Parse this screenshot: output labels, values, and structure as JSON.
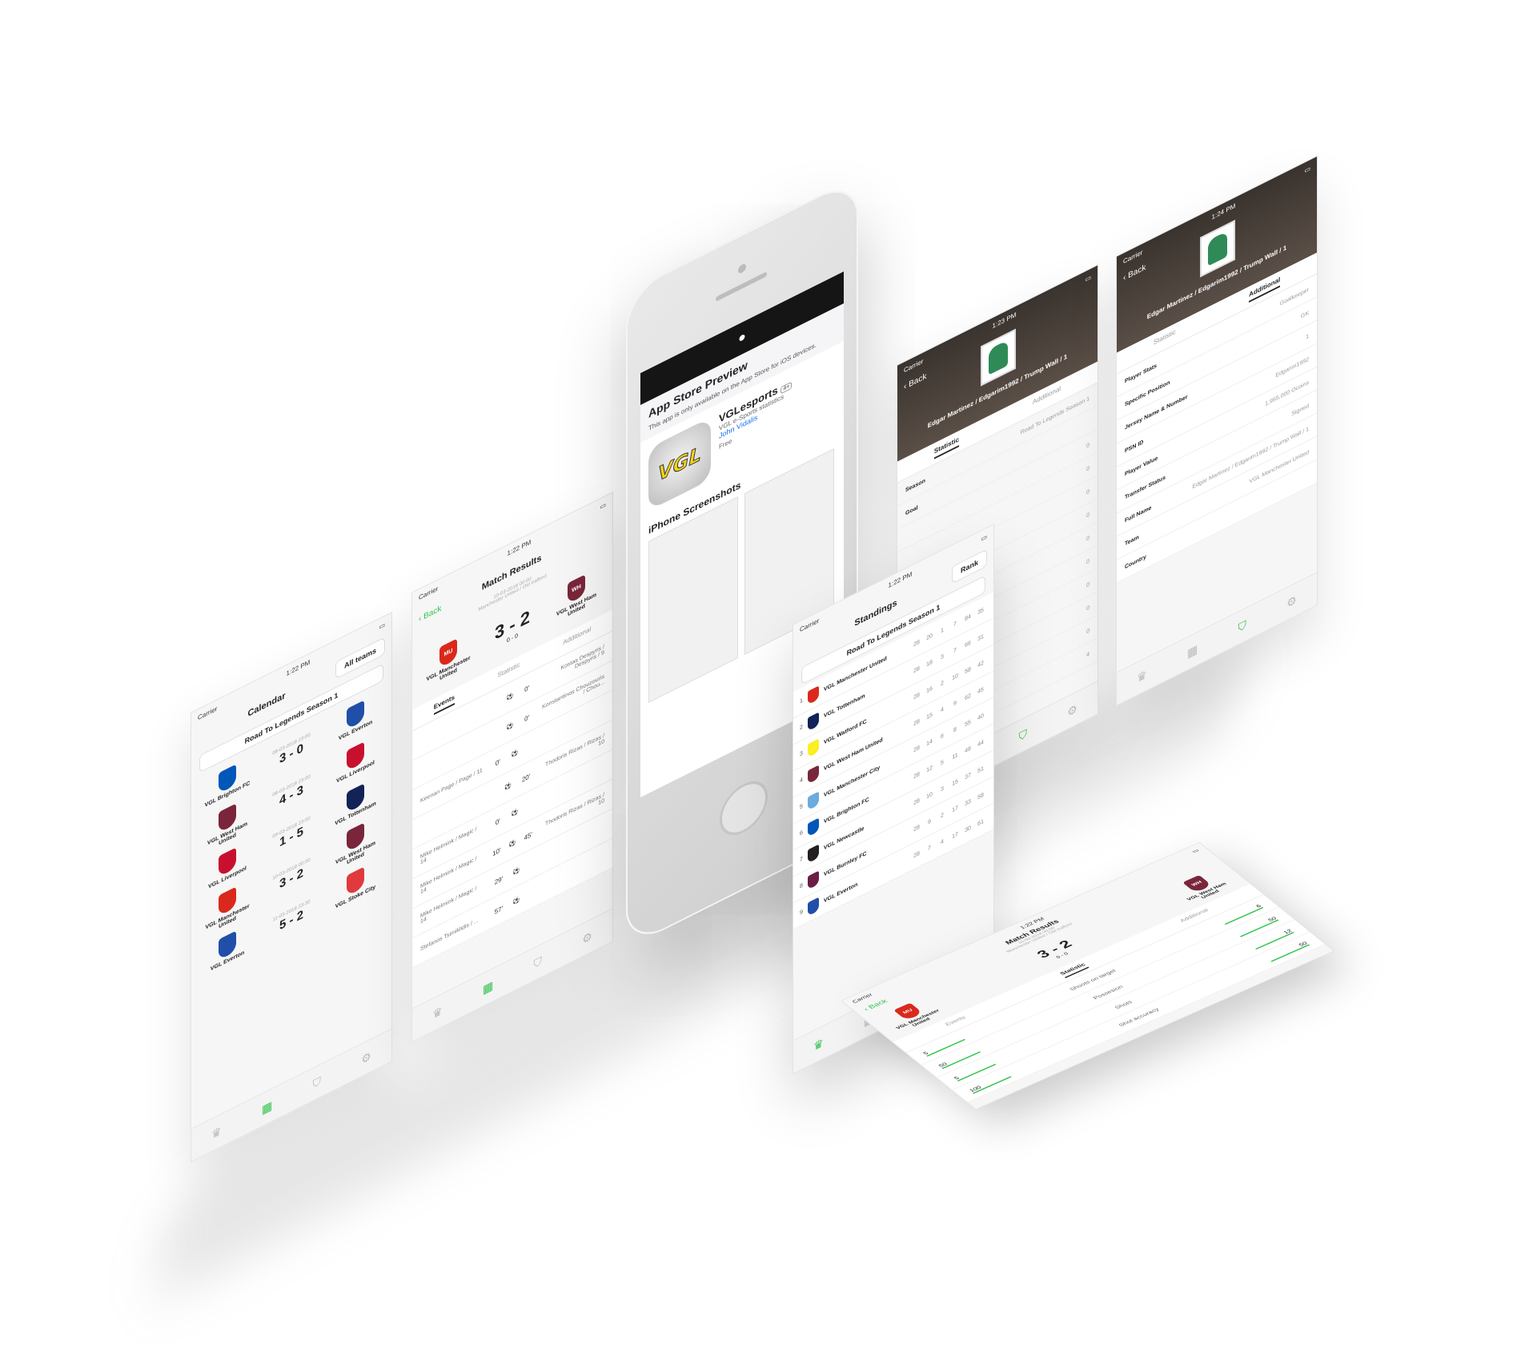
{
  "common": {
    "carrier": "Carrier",
    "back": "Back",
    "tabs": [
      "trophy-icon",
      "calendar-icon",
      "shirt-icon",
      "gear-icon"
    ]
  },
  "calendar": {
    "time": "1:22 PM",
    "title": "Calendar",
    "all_teams": "All teams",
    "season": "Road To Legends Season 1",
    "matches": [
      {
        "home": "VGL Brighton FC",
        "away": "VGL Everton",
        "date": "08-03-2018 23:00",
        "score": "3 - 0",
        "home_color": "#0057b8",
        "away_color": "#1f4fa8"
      },
      {
        "home": "VGL West Ham United",
        "away": "VGL Liverpool",
        "date": "08-03-2018 23:00",
        "score": "4 - 3",
        "home_color": "#7a263a",
        "away_color": "#c8102e"
      },
      {
        "home": "VGL Liverpool",
        "away": "VGL Tottenham",
        "date": "09-03-2018 23:00",
        "score": "1 - 5",
        "home_color": "#c8102e",
        "away_color": "#132257"
      },
      {
        "home": "VGL Manchester United",
        "away": "VGL West Ham United",
        "date": "10-03-2018 00:00",
        "score": "3 - 2",
        "home_color": "#da291c",
        "away_color": "#7a263a"
      },
      {
        "home": "VGL Everton",
        "away": "VGL Stoke City",
        "date": "11-03-2018 23:30",
        "score": "5 - 2",
        "home_color": "#1f4fa8",
        "away_color": "#e03a3e"
      }
    ]
  },
  "match": {
    "time": "1:22 PM",
    "title": "Match Results",
    "date": "10-03-2018 00:00",
    "venue": "Manchester United / Old trafford",
    "home": "VGL Manchester United",
    "away": "VGL West Ham United",
    "score": "3 - 2",
    "sub_score": "0 - 0",
    "tab_events": "Events",
    "tab_statistic": "Statistic",
    "tab_additional": "Additional",
    "events": [
      {
        "home": "",
        "home_min": "",
        "away": "Kostas Despyris / Despyris / 9",
        "away_min": "0'"
      },
      {
        "home": "",
        "home_min": "",
        "away": "Konstantinos Chouzouris / Chou...",
        "away_min": "0'"
      },
      {
        "home": "Keenan Page / Page / 11",
        "home_min": "0'",
        "away": "",
        "away_min": ""
      },
      {
        "home": "",
        "home_min": "",
        "away": "Thodoris Rizas / Rizas / 10",
        "away_min": "20'"
      },
      {
        "home": "Mike Helmink / Magic / 14",
        "home_min": "0'",
        "away": "",
        "away_min": ""
      },
      {
        "home": "Mike Helmink / Magic / 14",
        "home_min": "10'",
        "away": "Thodoris Rizas / Rizas / 10",
        "away_min": "45'"
      },
      {
        "home": "Mike Helmink / Magic / 14",
        "home_min": "29'",
        "away": "",
        "away_min": ""
      },
      {
        "home": "Stefanos Tsimiklidis / ...",
        "home_min": "57'",
        "away": "",
        "away_min": ""
      }
    ]
  },
  "appstore": {
    "header": "App Store Preview",
    "notice": "This app is only available on the App Store for iOS devices.",
    "app_name": "VGLesports",
    "age": "4+",
    "subtitle": "VGL e-Sports statistics",
    "developer": "John Vidalis",
    "price": "Free",
    "icon_text": "VGL",
    "screens_title": "iPhone Screenshots"
  },
  "standings": {
    "time": "1:22 PM",
    "title": "Standings",
    "season": "Road To Legends Season 1",
    "rank": "Rank",
    "teams": [
      {
        "pos": "1",
        "name": "VGL Manchester United",
        "color": "#da291c",
        "n": [
          "28",
          "20",
          "1",
          "7",
          "84",
          "35"
        ]
      },
      {
        "pos": "2",
        "name": "VGL Tottenham",
        "color": "#132257",
        "n": [
          "28",
          "18",
          "3",
          "7",
          "66",
          "31"
        ]
      },
      {
        "pos": "3",
        "name": "VGL Watford FC",
        "color": "#fbee23",
        "n": [
          "28",
          "16",
          "2",
          "10",
          "58",
          "42"
        ]
      },
      {
        "pos": "4",
        "name": "VGL West Ham United",
        "color": "#7a263a",
        "n": [
          "28",
          "15",
          "4",
          "9",
          "62",
          "45"
        ]
      },
      {
        "pos": "5",
        "name": "VGL Manchester City",
        "color": "#6cabdd",
        "n": [
          "28",
          "14",
          "6",
          "8",
          "55",
          "40"
        ]
      },
      {
        "pos": "6",
        "name": "VGL Brighton FC",
        "color": "#0057b8",
        "n": [
          "28",
          "12",
          "5",
          "11",
          "48",
          "44"
        ]
      },
      {
        "pos": "7",
        "name": "VGL Newcastle",
        "color": "#241f20",
        "n": [
          "28",
          "10",
          "3",
          "15",
          "37",
          "51"
        ]
      },
      {
        "pos": "8",
        "name": "VGL Burnley FC",
        "color": "#6c1d45",
        "n": [
          "28",
          "9",
          "2",
          "17",
          "33",
          "58"
        ]
      },
      {
        "pos": "9",
        "name": "VGL Everton",
        "color": "#1f4fa8",
        "n": [
          "28",
          "7",
          "4",
          "17",
          "30",
          "61"
        ]
      }
    ]
  },
  "player1": {
    "time": "1:23 PM",
    "name": "Edgar Martinez / Edgarim1992 / Trump Wall / 1",
    "tab_statistic": "Statistic",
    "tab_additional": "Additional",
    "season_label": "Season",
    "season_value": "Road To Legends Season 1",
    "goal_label": "Goal",
    "values": [
      "0",
      "0",
      "0",
      "0",
      "0",
      "0",
      "0",
      "0",
      "0",
      "4"
    ]
  },
  "player2": {
    "time": "1:24 PM",
    "name": "Edgar Martinez / Edgarim1992 / Trump Wall / 1",
    "tab_statistic": "Statistic",
    "tab_additional": "Additional",
    "rows": [
      {
        "k": "Player Stats",
        "v": "Goalkeeper"
      },
      {
        "k": "Specific Position",
        "v": "GK"
      },
      {
        "k": "Jersey Name & Number",
        "v": "1"
      },
      {
        "k": "PSN ID",
        "v": "Edgarim1992"
      },
      {
        "k": "Player Value",
        "v": "1,955,000 Ocoins"
      },
      {
        "k": "Transfer Status",
        "v": "Signed"
      },
      {
        "k": "Full Name",
        "v": "Edgar Martinez / Edgarim1992 / Trump Wall / 1"
      },
      {
        "k": "Team",
        "v": "VGL Manchester United"
      },
      {
        "k": "Country",
        "v": ""
      }
    ]
  },
  "stats": {
    "time": "1:22 PM",
    "title": "Match Results",
    "date": "10-03-2018 00:00",
    "venue": "Manchester United / Old trafford",
    "home": "VGL Manchester United",
    "away": "VGL West Ham United",
    "score": "3 - 2",
    "sub_score": "0 - 0",
    "tab_events": "Events",
    "tab_statistic": "Statistic",
    "tab_additional": "Additional",
    "rows": [
      {
        "label": "Shoots on target",
        "home": "5",
        "away": "6"
      },
      {
        "label": "Possesion",
        "home": "50",
        "away": "50"
      },
      {
        "label": "Shots",
        "home": "5",
        "away": "12"
      },
      {
        "label": "Shot accuracy",
        "home": "100",
        "away": "50"
      }
    ]
  }
}
